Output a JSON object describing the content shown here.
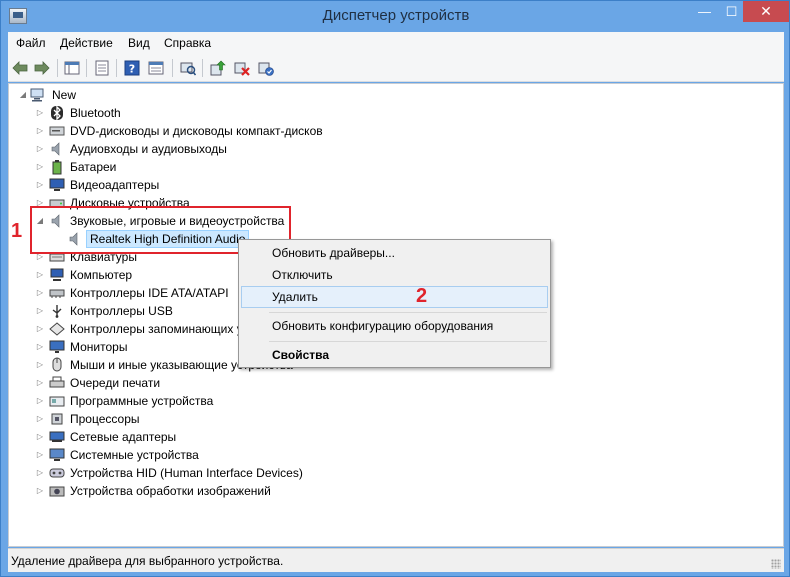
{
  "window": {
    "title": "Диспетчер устройств",
    "min_glyph": "—",
    "max_glyph": "☐",
    "close_glyph": "✕"
  },
  "menu": [
    "Файл",
    "Действие",
    "Вид",
    "Справка"
  ],
  "tree": {
    "root": "New",
    "items": [
      {
        "label": "Bluetooth",
        "icon": "bluetooth-icon"
      },
      {
        "label": "DVD-дисководы и дисководы компакт-дисков",
        "icon": "dvd-icon"
      },
      {
        "label": "Аудиовходы и аудиовыходы",
        "icon": "speaker-icon"
      },
      {
        "label": "Батареи",
        "icon": "battery-icon"
      },
      {
        "label": "Видеоадаптеры",
        "icon": "display-adapter-icon"
      },
      {
        "label": "Дисковые устройства",
        "icon": "disk-icon"
      },
      {
        "label": "Звуковые, игровые и видеоустройства",
        "icon": "speaker-icon",
        "expanded": true
      },
      {
        "label": "Клавиатуры",
        "icon": "keyboard-icon"
      },
      {
        "label": "Компьютер",
        "icon": "computer-icon"
      },
      {
        "label": "Контроллеры IDE ATA/ATAPI",
        "icon": "controller-icon"
      },
      {
        "label": "Контроллеры USB",
        "icon": "usb-icon"
      },
      {
        "label": "Контроллеры запоминающих устройств",
        "icon": "storage-controller-icon"
      },
      {
        "label": "Мониторы",
        "icon": "monitor-icon"
      },
      {
        "label": "Мыши и иные указывающие устройства",
        "icon": "mouse-icon"
      },
      {
        "label": "Очереди печати",
        "icon": "printer-icon"
      },
      {
        "label": "Программные устройства",
        "icon": "software-device-icon"
      },
      {
        "label": "Процессоры",
        "icon": "processor-icon"
      },
      {
        "label": "Сетевые адаптеры",
        "icon": "network-icon"
      },
      {
        "label": "Системные устройства",
        "icon": "system-icon"
      },
      {
        "label": "Устройства HID (Human Interface Devices)",
        "icon": "hid-icon"
      },
      {
        "label": "Устройства обработки изображений",
        "icon": "camera-icon"
      }
    ],
    "child": "Realtek High Definition Audio"
  },
  "context_menu": {
    "items": [
      "Обновить драйверы...",
      "Отключить",
      "Удалить",
      "Обновить конфигурацию оборудования",
      "Свойства"
    ]
  },
  "markers": {
    "one": "1",
    "two": "2"
  },
  "status": "Удаление драйвера для выбранного устройства.",
  "colors": {
    "highlight": "#e0242c",
    "selection": "#cce8ff",
    "menu_hover": "#e5f0fb"
  }
}
